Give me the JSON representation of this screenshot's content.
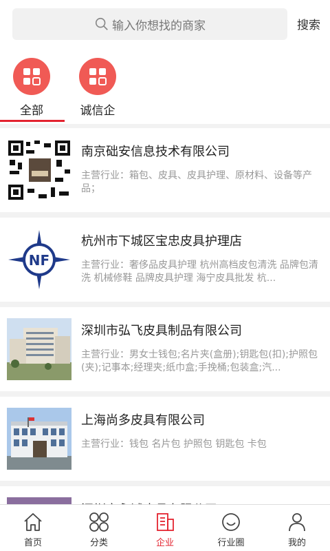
{
  "search": {
    "placeholder": "输入你想找的商家",
    "button": "搜索"
  },
  "categories": [
    {
      "label": "全部",
      "icon": "grid-icon",
      "active": true
    },
    {
      "label": "诚信企",
      "icon": "grid-icon",
      "active": false
    }
  ],
  "companies": [
    {
      "name": "南京础安信息技术有限公司",
      "desc": "主营行业：箱包、皮具、皮具护理、原材料、设备等产品；",
      "thumb": "qr-code-thumbnail"
    },
    {
      "name": "杭州市下城区宝忠皮具护理店",
      "desc": "主营行业：奢侈品皮具护理 杭州高档皮包清洗 品牌包清洗 机械修鞋 品牌皮具护理 海宁皮具批发 杭...",
      "thumb": "nf-logo-thumbnail"
    },
    {
      "name": "深圳市弘飞皮具制品有限公司",
      "desc": "主营行业：男女士钱包;名片夹(盒册);钥匙包(扣);护照包(夹);记事本;经理夹;纸巾盒;手挽桶;包装盒;汽...",
      "thumb": "factory-photo-thumbnail"
    },
    {
      "name": "上海尚多皮具有限公司",
      "desc": "主营行业：钱包 名片包 护照包 钥匙包 卡包",
      "thumb": "building-photo-thumbnail"
    },
    {
      "name": "深圳市永诚皮具有限公司",
      "desc": "",
      "thumb": "photo-thumbnail"
    }
  ],
  "tabs": [
    {
      "label": "首页",
      "icon": "home-icon"
    },
    {
      "label": "分类",
      "icon": "category-icon"
    },
    {
      "label": "企业",
      "icon": "enterprise-icon"
    },
    {
      "label": "行业圈",
      "icon": "smile-icon"
    },
    {
      "label": "我的",
      "icon": "user-icon"
    }
  ],
  "colors": {
    "accent": "#e3232f",
    "category_circle": "#f05a55"
  }
}
